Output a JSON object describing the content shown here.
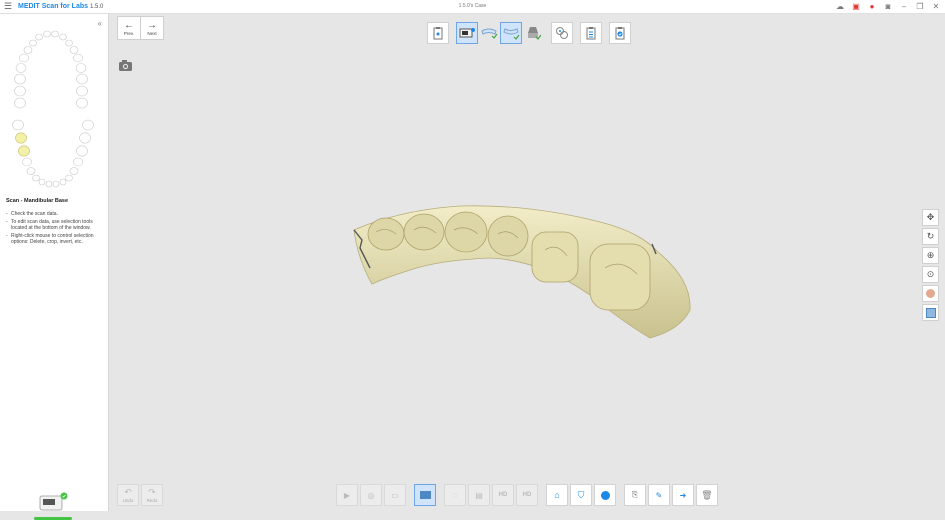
{
  "titlebar": {
    "menu_icon": "hamburger-icon",
    "brand": "MEDIT",
    "app_name": "Scan for Labs",
    "version": "1.5.0",
    "case_name": "1.5.0's Case"
  },
  "left_panel": {
    "collapse_icon": "double-chevron-left-icon",
    "step_title": "Scan - Mandibular Base",
    "instructions": [
      "Check the scan data.",
      "To edit scan data, use selection tools located at the bottom of the window.",
      "Right-click mouse to control selection options: Delete, crop, invert, etc."
    ]
  },
  "nav": {
    "prev_label": "Prev.",
    "next_label": "Next"
  },
  "bottom": {
    "undo_label": "Undo",
    "redo_label": "Redo"
  },
  "colors": {
    "accent": "#1e88e5",
    "highlight_tooth": "#f3f0a8",
    "scan_model": "#e8e2b8",
    "status_green": "#43c443",
    "record_red": "#e53935"
  }
}
